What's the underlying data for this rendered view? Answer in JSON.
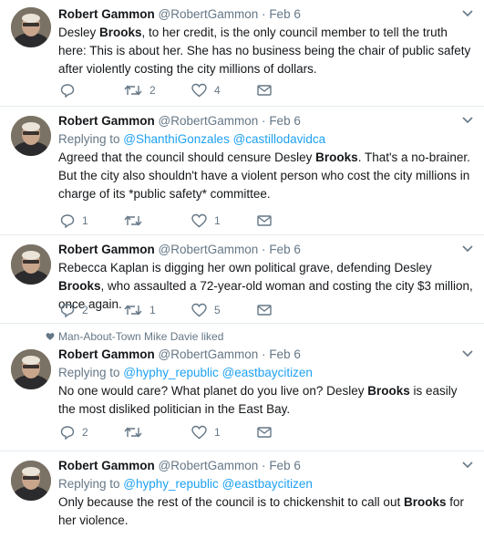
{
  "tweets": [
    {
      "name": "Robert Gammon",
      "handle": "@RobertGammon",
      "sep": "·",
      "time": "Feb 6",
      "reply_to": null,
      "text_parts": [
        "Desley ",
        "Brooks",
        ", to her credit, is the only council member to tell the truth here: This is about her. She has no business being the chair of public safety after violently costing the city millions of dollars."
      ],
      "reply_count": "",
      "retweet_count": "2",
      "like_count": "4"
    },
    {
      "name": "Robert Gammon",
      "handle": "@RobertGammon",
      "sep": "·",
      "time": "Feb 6",
      "reply_to": {
        "prefix": "Replying to ",
        "user1": "@ShanthiGonzales",
        "user2": "@castillodavidca"
      },
      "text_parts": [
        "Agreed that the council should censure Desley ",
        "Brooks",
        ". That's  a no-brainer. But the city also shouldn't have a violent person who cost the city millions in charge of its *public safety* committee."
      ],
      "reply_count": "1",
      "retweet_count": "",
      "like_count": "1"
    },
    {
      "name": "Robert Gammon",
      "handle": "@RobertGammon",
      "sep": "·",
      "time": "Feb 6",
      "reply_to": null,
      "text_parts": [
        "Rebecca Kaplan is digging her own political grave, defending Desley ",
        "Brooks",
        ", who assaulted a 72-year-old woman and costing the city $3 million, once again."
      ],
      "reply_count": "2",
      "retweet_count": "1",
      "like_count": "5"
    },
    {
      "liked_by": "Man-About-Town Mike Davie liked",
      "name": "Robert Gammon",
      "handle": "@RobertGammon",
      "sep": "·",
      "time": "Feb 6",
      "reply_to": {
        "prefix": "Replying to ",
        "user1": "@hyphy_republic",
        "user2": "@eastbaycitizen"
      },
      "text_parts": [
        "No one would care? What planet do you live on? Desley ",
        "Brooks",
        " is easily the most disliked politician in the East Bay."
      ],
      "reply_count": "2",
      "retweet_count": "",
      "like_count": "1"
    },
    {
      "name": "Robert Gammon",
      "handle": "@RobertGammon",
      "sep": "·",
      "time": "Feb 6",
      "reply_to": {
        "prefix": "Replying to ",
        "user1": "@hyphy_republic",
        "user2": "@eastbaycitizen"
      },
      "text_parts": [
        "Only because the rest of the council is to chickenshit to call out ",
        "Brooks",
        " for her violence."
      ],
      "reply_count": "",
      "retweet_count": "",
      "like_count": ""
    }
  ]
}
